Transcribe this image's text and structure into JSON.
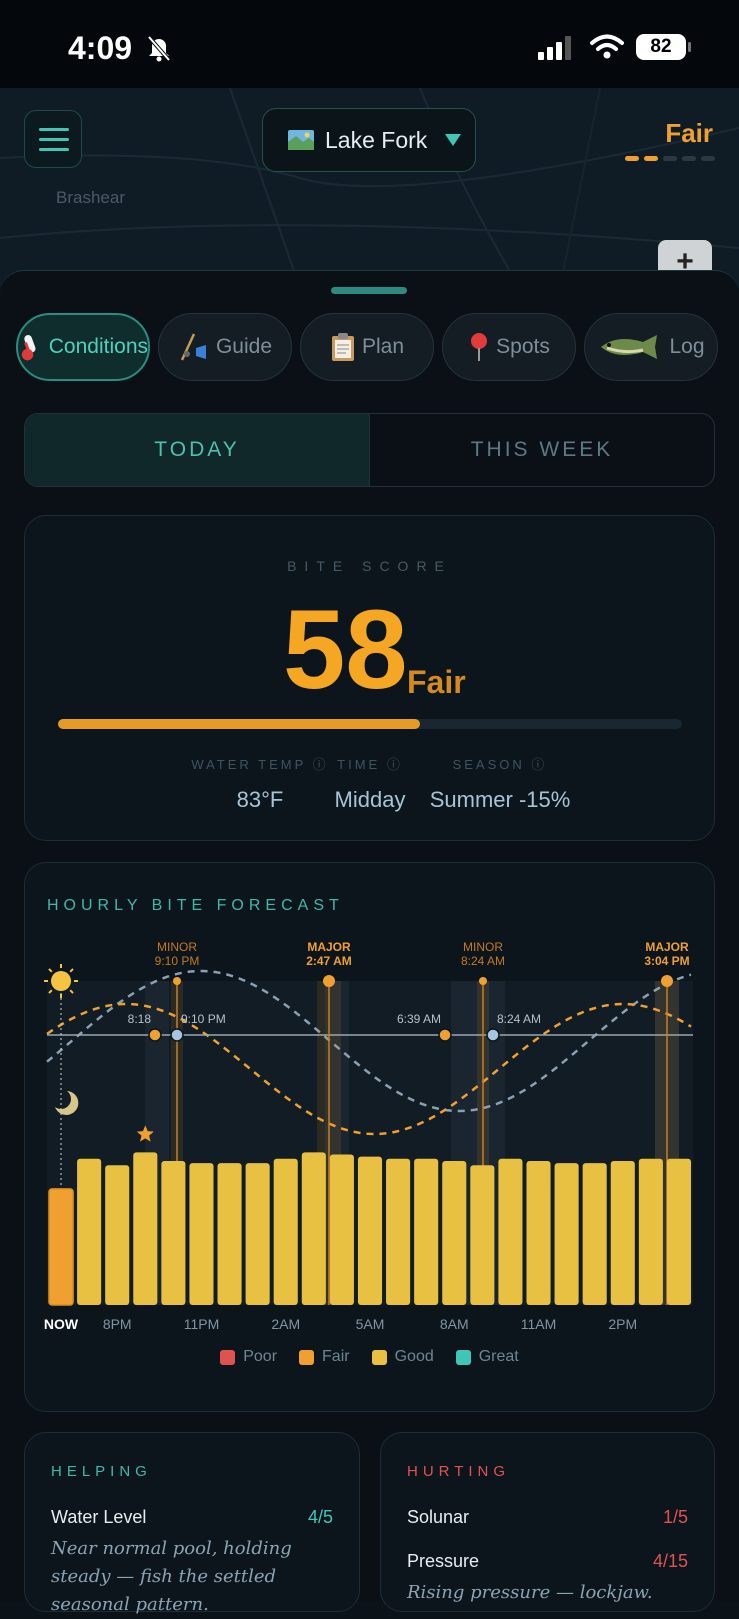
{
  "status_bar": {
    "time": "4:09",
    "battery": "82"
  },
  "map": {
    "place_label": "Brashear",
    "zoom_label": "+"
  },
  "header": {
    "location": "Lake Fork",
    "rating": "Fair",
    "rating_level": {
      "filled": 2,
      "total": 5
    }
  },
  "nav": {
    "tabs": [
      {
        "label": "Conditions",
        "icon": "thermometer-icon",
        "active": true
      },
      {
        "label": "Guide",
        "icon": "fishing-rod-icon",
        "active": false
      },
      {
        "label": "Plan",
        "icon": "clipboard-icon",
        "active": false
      },
      {
        "label": "Spots",
        "icon": "pin-icon",
        "active": false
      },
      {
        "label": "Log",
        "icon": "fish-icon",
        "active": false
      }
    ]
  },
  "period": {
    "today": "TODAY",
    "week": "THIS WEEK",
    "selected": "TODAY"
  },
  "bite_score": {
    "label": "BITE SCORE",
    "value": "58",
    "rating": "Fair",
    "progress": 0.58,
    "metrics": [
      {
        "label": "WATER TEMP ⓘ",
        "value": "83°F"
      },
      {
        "label": "TIME ⓘ",
        "value": "Midday"
      },
      {
        "label": "SEASON ⓘ",
        "value": "Summer -15%"
      }
    ]
  },
  "chart_data": {
    "type": "bar",
    "title": "HOURLY BITE FORECAST",
    "categories": [
      "NOW",
      "7PM",
      "8PM",
      "9PM",
      "10PM",
      "11PM",
      "12AM",
      "1AM",
      "2AM",
      "3AM",
      "4AM",
      "5AM",
      "6AM",
      "7AM",
      "8AM",
      "9AM",
      "10AM",
      "11AM",
      "12PM",
      "1PM",
      "2PM",
      "3PM",
      "4PM"
    ],
    "x_tick_labels": [
      "NOW",
      "8PM",
      "11PM",
      "2AM",
      "5AM",
      "8AM",
      "11AM",
      "2PM"
    ],
    "series": [
      {
        "values": [
          54,
          68,
          65,
          71,
          67,
          66,
          66,
          66,
          68,
          71,
          70,
          69,
          68,
          68,
          67,
          65,
          68,
          67,
          66,
          66,
          67,
          68,
          68
        ]
      }
    ],
    "ylim": [
      0,
      100
    ],
    "current_color": "#f0a030",
    "bar_color": "#e8c143",
    "best_hour_marker": "star-icon",
    "solunar_periods": [
      {
        "type": "MINOR",
        "time": "9:10 PM"
      },
      {
        "type": "MAJOR",
        "time": "2:47 AM"
      },
      {
        "type": "MINOR",
        "time": "8:24 AM"
      },
      {
        "type": "MAJOR",
        "time": "3:04 PM"
      }
    ],
    "crossing_labels": [
      "8:18",
      "9:10 PM",
      "6:39 AM",
      "8:24 AM"
    ],
    "legend": [
      {
        "label": "Poor",
        "color": "#e05252"
      },
      {
        "label": "Fair",
        "color": "#f0a030"
      },
      {
        "label": "Good",
        "color": "#e8c143"
      },
      {
        "label": "Great",
        "color": "#3fc6b4"
      }
    ]
  },
  "helping": {
    "title": "HELPING",
    "items": [
      {
        "name": "Water Level",
        "score": "4/5",
        "desc": "Near normal pool, holding steady — fish the settled seasonal pattern."
      }
    ]
  },
  "hurting": {
    "title": "HURTING",
    "items": [
      {
        "name": "Solunar",
        "score": "1/5"
      },
      {
        "name": "Pressure",
        "score": "4/15",
        "desc": "Rising pressure — lockjaw."
      }
    ]
  }
}
